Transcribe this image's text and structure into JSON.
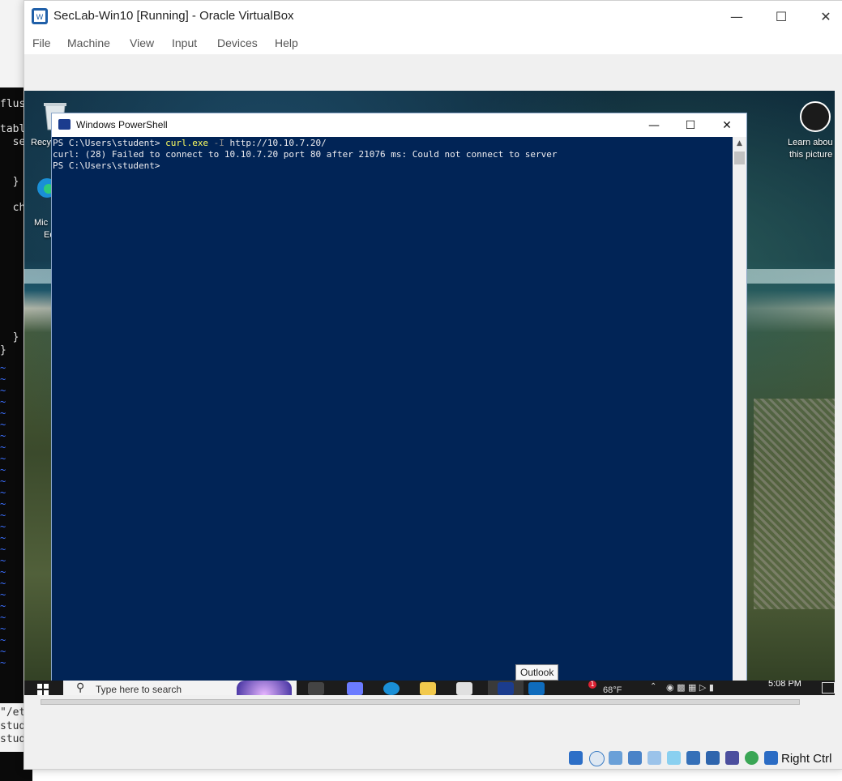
{
  "host_editor": {
    "lines_top": [
      "flus",
      "tabl",
      "  se",
      "  }",
      "  ch",
      "  }",
      "}"
    ],
    "lines_bottom": [
      "\"/et",
      "stud",
      "stud"
    ]
  },
  "vbox": {
    "title": "SecLab-Win10 [Running] - Oracle VirtualBox",
    "menu": [
      "File",
      "Machine",
      "View",
      "Input",
      "Devices",
      "Help"
    ],
    "host_key": "Right Ctrl"
  },
  "desktop": {
    "recycle_bin_label": "Recy",
    "edge_label_1": "Mic",
    "edge_label_2": "Ed",
    "learn_label_1": "Learn abou",
    "learn_label_2": "this picture"
  },
  "powershell": {
    "title": "Windows PowerShell",
    "lines": [
      {
        "prompt": "PS C:\\Users\\student> ",
        "cmd": "curl.exe",
        "flag": " -I",
        "rest": " http://10.10.7.20/"
      },
      {
        "prompt": "curl: (28) Failed to connect to 10.10.7.20 port 80 after 21076 ms: Could not connect to server",
        "cmd": "",
        "flag": "",
        "rest": ""
      },
      {
        "prompt": "PS C:\\Users\\student>",
        "cmd": "",
        "flag": "",
        "rest": ""
      }
    ]
  },
  "tooltip": "Outlook",
  "taskbar": {
    "search_placeholder": "Type here to search",
    "clock": "5:08 PM",
    "temperature": "68°F",
    "notification_badge": "1"
  },
  "colors": {
    "console_bg": "#012456",
    "console_fg": "#eeedf0",
    "command": "#ffff60"
  }
}
